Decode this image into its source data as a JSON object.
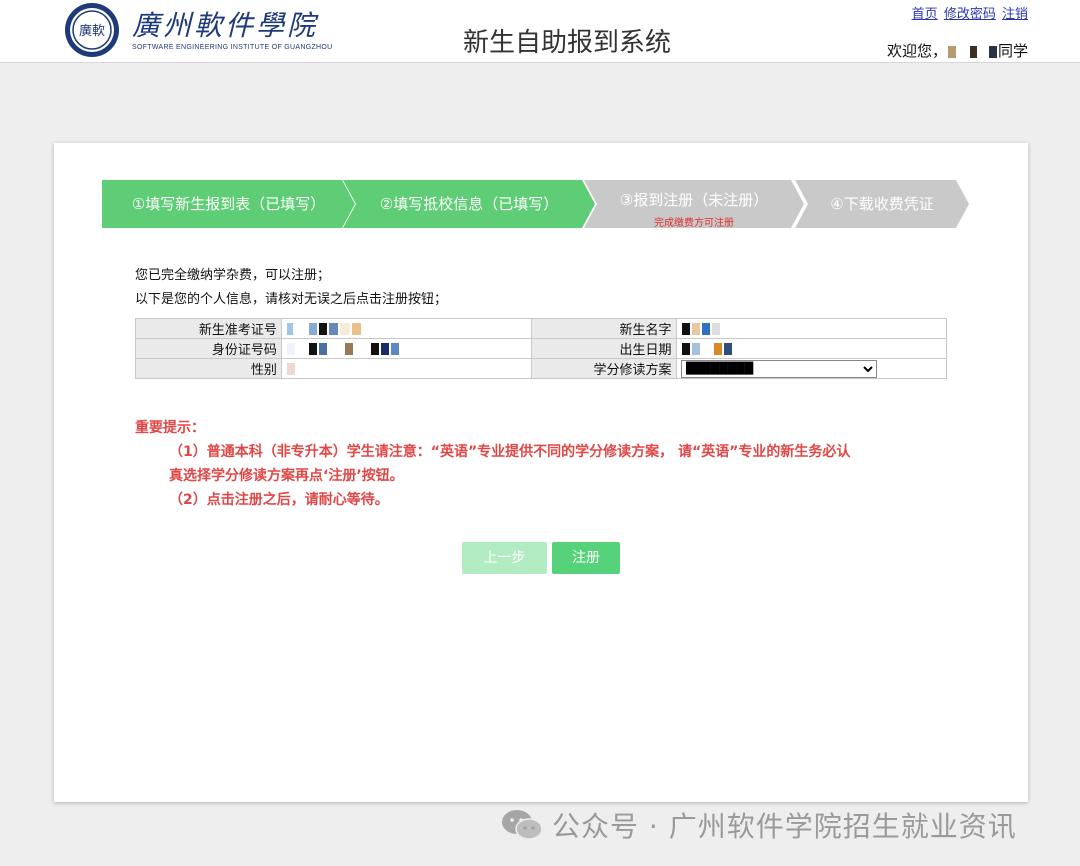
{
  "header": {
    "logo_cn": "廣州軟件學院",
    "logo_en": "SOFTWARE ENGINEERING INSTITUTE OF GUANGZHOU",
    "logo_seal": "廣軟",
    "system_title": "新生自助报到系统",
    "links": [
      "首页",
      "修改密码",
      "注销"
    ],
    "welcome_prefix": "欢迎您，",
    "welcome_suffix": "同学"
  },
  "steps": [
    {
      "label": "①填写新生报到表（已填写）",
      "sub": "",
      "state": "done"
    },
    {
      "label": "②填写抵校信息（已填写）",
      "sub": "",
      "state": "done"
    },
    {
      "label": "③报到注册（未注册）",
      "sub": "完成缴费方可注册",
      "state": "current"
    },
    {
      "label": "④下载收费凭证",
      "sub": "",
      "state": "pending"
    }
  ],
  "intro": {
    "line1": "您已完全缴纳学杂费，可以注册；",
    "line2": "以下是您的个人信息，请核对无误之后点击注册按钮；"
  },
  "info_table": {
    "exam_no_label": "新生准考证号",
    "name_label": "新生名字",
    "id_label": "身份证号码",
    "birth_label": "出生日期",
    "gender_label": "性别",
    "plan_label": "学分修读方案"
  },
  "notice": {
    "title": "重要提示：",
    "item1": "（1）普通本科（非专升本）学生请注意：“英语”专业提供不同的学分修读方案， 请“英语”专业的新生务必认",
    "item1_cont": "真选择学分修读方案再点‘注册’按钮。",
    "item2": "（2）点击注册之后，请耐心等待。"
  },
  "buttons": {
    "prev": "上一步",
    "register": "注册"
  },
  "watermark": "公众号 · 广州软件学院招生就业资讯",
  "colors": {
    "step_done": "#5fcd75",
    "step_pending": "#c9c9c9",
    "notice_red": "#e04848",
    "link_blue": "#2a35b0"
  }
}
